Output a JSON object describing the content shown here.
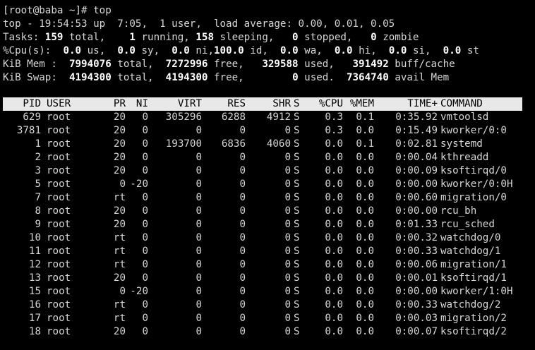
{
  "prompt": "[root@baba ~]# top",
  "summary": {
    "line1": "top - 19:54:53 up  7:05,  1 user,  load average: 0.00, 0.01, 0.05",
    "tasks": {
      "label": "Tasks:",
      "total": "159",
      "total_label": "total,",
      "running": "1",
      "running_label": "running,",
      "sleeping": "158",
      "sleeping_label": "sleeping,",
      "stopped": "0",
      "stopped_label": "stopped,",
      "zombie": "0",
      "zombie_label": "zombie"
    },
    "cpu": {
      "label": "%Cpu(s):",
      "us": "0.0",
      "us_label": "us,",
      "sy": "0.0",
      "sy_label": "sy,",
      "ni": "0.0",
      "ni_label": "ni,",
      "id": "100.0",
      "id_label": "id,",
      "wa": "0.0",
      "wa_label": "wa,",
      "hi": "0.0",
      "hi_label": "hi,",
      "si": "0.0",
      "si_label": "si,",
      "st": "0.0",
      "st_label": "st"
    },
    "mem": {
      "label": "KiB Mem :",
      "total": "7994076",
      "total_label": "total,",
      "free": "7272996",
      "free_label": "free,",
      "used": "329588",
      "used_label": "used,",
      "buff": "391492",
      "buff_label": "buff/cache"
    },
    "swap": {
      "label": "KiB Swap:",
      "total": "4194300",
      "total_label": "total,",
      "free": "4194300",
      "free_label": "free,",
      "used": "0",
      "used_label": "used.",
      "avail": "7364740",
      "avail_label": "avail Mem"
    }
  },
  "table": {
    "headers": {
      "pid": "PID",
      "user": "USER",
      "pr": "PR",
      "ni": "NI",
      "virt": "VIRT",
      "res": "RES",
      "shr": "SHR",
      "s": "S",
      "cpu": "%CPU",
      "mem": "%MEM",
      "time": "TIME+",
      "command": "COMMAND"
    },
    "rows": [
      {
        "pid": "629",
        "user": "root",
        "pr": "20",
        "ni": "0",
        "virt": "305296",
        "res": "6288",
        "shr": "4912",
        "s": "S",
        "cpu": "0.3",
        "mem": "0.1",
        "time": "0:35.92",
        "command": "vmtoolsd"
      },
      {
        "pid": "3781",
        "user": "root",
        "pr": "20",
        "ni": "0",
        "virt": "0",
        "res": "0",
        "shr": "0",
        "s": "S",
        "cpu": "0.3",
        "mem": "0.0",
        "time": "0:15.49",
        "command": "kworker/0:0"
      },
      {
        "pid": "1",
        "user": "root",
        "pr": "20",
        "ni": "0",
        "virt": "193700",
        "res": "6836",
        "shr": "4060",
        "s": "S",
        "cpu": "0.0",
        "mem": "0.1",
        "time": "0:02.81",
        "command": "systemd"
      },
      {
        "pid": "2",
        "user": "root",
        "pr": "20",
        "ni": "0",
        "virt": "0",
        "res": "0",
        "shr": "0",
        "s": "S",
        "cpu": "0.0",
        "mem": "0.0",
        "time": "0:00.04",
        "command": "kthreadd"
      },
      {
        "pid": "3",
        "user": "root",
        "pr": "20",
        "ni": "0",
        "virt": "0",
        "res": "0",
        "shr": "0",
        "s": "S",
        "cpu": "0.0",
        "mem": "0.0",
        "time": "0:00.09",
        "command": "ksoftirqd/0"
      },
      {
        "pid": "5",
        "user": "root",
        "pr": "0",
        "ni": "-20",
        "virt": "0",
        "res": "0",
        "shr": "0",
        "s": "S",
        "cpu": "0.0",
        "mem": "0.0",
        "time": "0:00.00",
        "command": "kworker/0:0H"
      },
      {
        "pid": "7",
        "user": "root",
        "pr": "rt",
        "ni": "0",
        "virt": "0",
        "res": "0",
        "shr": "0",
        "s": "S",
        "cpu": "0.0",
        "mem": "0.0",
        "time": "0:00.60",
        "command": "migration/0"
      },
      {
        "pid": "8",
        "user": "root",
        "pr": "20",
        "ni": "0",
        "virt": "0",
        "res": "0",
        "shr": "0",
        "s": "S",
        "cpu": "0.0",
        "mem": "0.0",
        "time": "0:00.00",
        "command": "rcu_bh"
      },
      {
        "pid": "9",
        "user": "root",
        "pr": "20",
        "ni": "0",
        "virt": "0",
        "res": "0",
        "shr": "0",
        "s": "S",
        "cpu": "0.0",
        "mem": "0.0",
        "time": "0:01.33",
        "command": "rcu_sched"
      },
      {
        "pid": "10",
        "user": "root",
        "pr": "rt",
        "ni": "0",
        "virt": "0",
        "res": "0",
        "shr": "0",
        "s": "S",
        "cpu": "0.0",
        "mem": "0.0",
        "time": "0:00.32",
        "command": "watchdog/0"
      },
      {
        "pid": "11",
        "user": "root",
        "pr": "rt",
        "ni": "0",
        "virt": "0",
        "res": "0",
        "shr": "0",
        "s": "S",
        "cpu": "0.0",
        "mem": "0.0",
        "time": "0:00.33",
        "command": "watchdog/1"
      },
      {
        "pid": "12",
        "user": "root",
        "pr": "rt",
        "ni": "0",
        "virt": "0",
        "res": "0",
        "shr": "0",
        "s": "S",
        "cpu": "0.0",
        "mem": "0.0",
        "time": "0:00.06",
        "command": "migration/1"
      },
      {
        "pid": "13",
        "user": "root",
        "pr": "20",
        "ni": "0",
        "virt": "0",
        "res": "0",
        "shr": "0",
        "s": "S",
        "cpu": "0.0",
        "mem": "0.0",
        "time": "0:00.01",
        "command": "ksoftirqd/1"
      },
      {
        "pid": "15",
        "user": "root",
        "pr": "0",
        "ni": "-20",
        "virt": "0",
        "res": "0",
        "shr": "0",
        "s": "S",
        "cpu": "0.0",
        "mem": "0.0",
        "time": "0:00.00",
        "command": "kworker/1:0H"
      },
      {
        "pid": "16",
        "user": "root",
        "pr": "rt",
        "ni": "0",
        "virt": "0",
        "res": "0",
        "shr": "0",
        "s": "S",
        "cpu": "0.0",
        "mem": "0.0",
        "time": "0:00.33",
        "command": "watchdog/2"
      },
      {
        "pid": "17",
        "user": "root",
        "pr": "rt",
        "ni": "0",
        "virt": "0",
        "res": "0",
        "shr": "0",
        "s": "S",
        "cpu": "0.0",
        "mem": "0.0",
        "time": "0:00.03",
        "command": "migration/2"
      },
      {
        "pid": "18",
        "user": "root",
        "pr": "20",
        "ni": "0",
        "virt": "0",
        "res": "0",
        "shr": "0",
        "s": "S",
        "cpu": "0.0",
        "mem": "0.0",
        "time": "0:00.07",
        "command": "ksoftirqd/2"
      }
    ]
  },
  "colors": {
    "background": "#000000",
    "text": "#d6d6d6",
    "bold": "#ffffff",
    "header_bg": "#e8e8e8",
    "header_text": "#000000"
  }
}
